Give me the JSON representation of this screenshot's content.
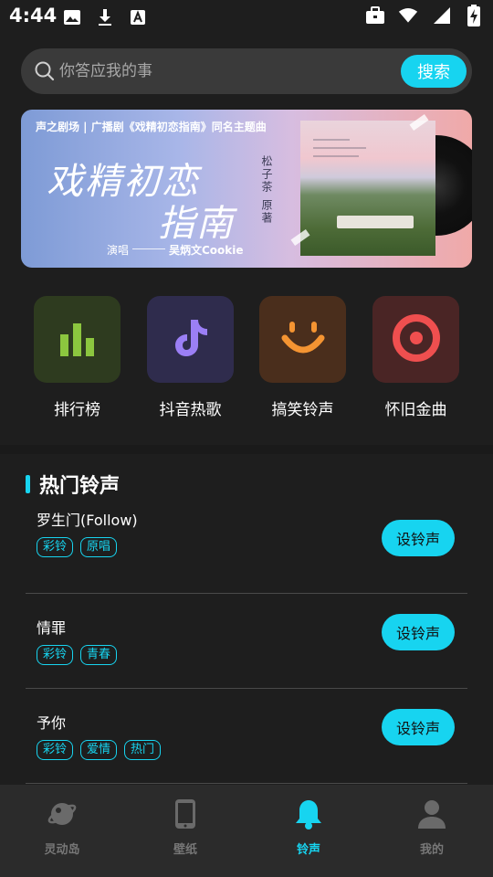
{
  "status_bar": {
    "time": "4:44",
    "icons_left": [
      "image-icon",
      "download-icon",
      "font-icon"
    ],
    "icons_right": [
      "briefcase-icon",
      "wifi-icon",
      "signal-icon",
      "battery-charging-icon"
    ]
  },
  "search": {
    "placeholder": "你答应我的事",
    "button_label": "搜索"
  },
  "banner": {
    "top_line": "声之剧场 | 广播剧《戏精初恋指南》同名主题曲",
    "title_line1": "戏精初恋",
    "title_line2": "指南",
    "sing_label": "演唱",
    "artist": "吴炳文Cookie",
    "vertical_text": "松子茶 原著"
  },
  "categories": [
    {
      "label": "排行榜",
      "icon": "bar-chart-icon",
      "bg": "#2e3b1f",
      "color": "#8cc63f"
    },
    {
      "label": "抖音热歌",
      "icon": "tiktok-icon",
      "bg": "#2f2c4d",
      "color": "#9b7ff5"
    },
    {
      "label": "搞笑铃声",
      "icon": "smile-icon",
      "bg": "#4a2e1c",
      "color": "#f49432"
    },
    {
      "label": "怀旧金曲",
      "icon": "target-icon",
      "bg": "#4a2525",
      "color": "#ef4f4f"
    }
  ],
  "section": {
    "title": "热门铃声"
  },
  "songs": [
    {
      "name": "罗生门(Follow)",
      "tags": [
        "彩铃",
        "原唱"
      ],
      "button": "设铃声"
    },
    {
      "name": "情罪",
      "tags": [
        "彩铃",
        "青春"
      ],
      "button": "设铃声"
    },
    {
      "name": "予你",
      "tags": [
        "彩铃",
        "爱情",
        "热门"
      ],
      "button": "设铃声"
    }
  ],
  "bottom_nav": [
    {
      "label": "灵动岛",
      "icon": "planet-icon",
      "active": false
    },
    {
      "label": "壁纸",
      "icon": "phone-icon",
      "active": false
    },
    {
      "label": "铃声",
      "icon": "bell-icon",
      "active": true
    },
    {
      "label": "我的",
      "icon": "person-icon",
      "active": false
    }
  ],
  "colors": {
    "accent": "#17d4f0",
    "background": "#1e1e1e",
    "nav_inactive": "#777777"
  }
}
